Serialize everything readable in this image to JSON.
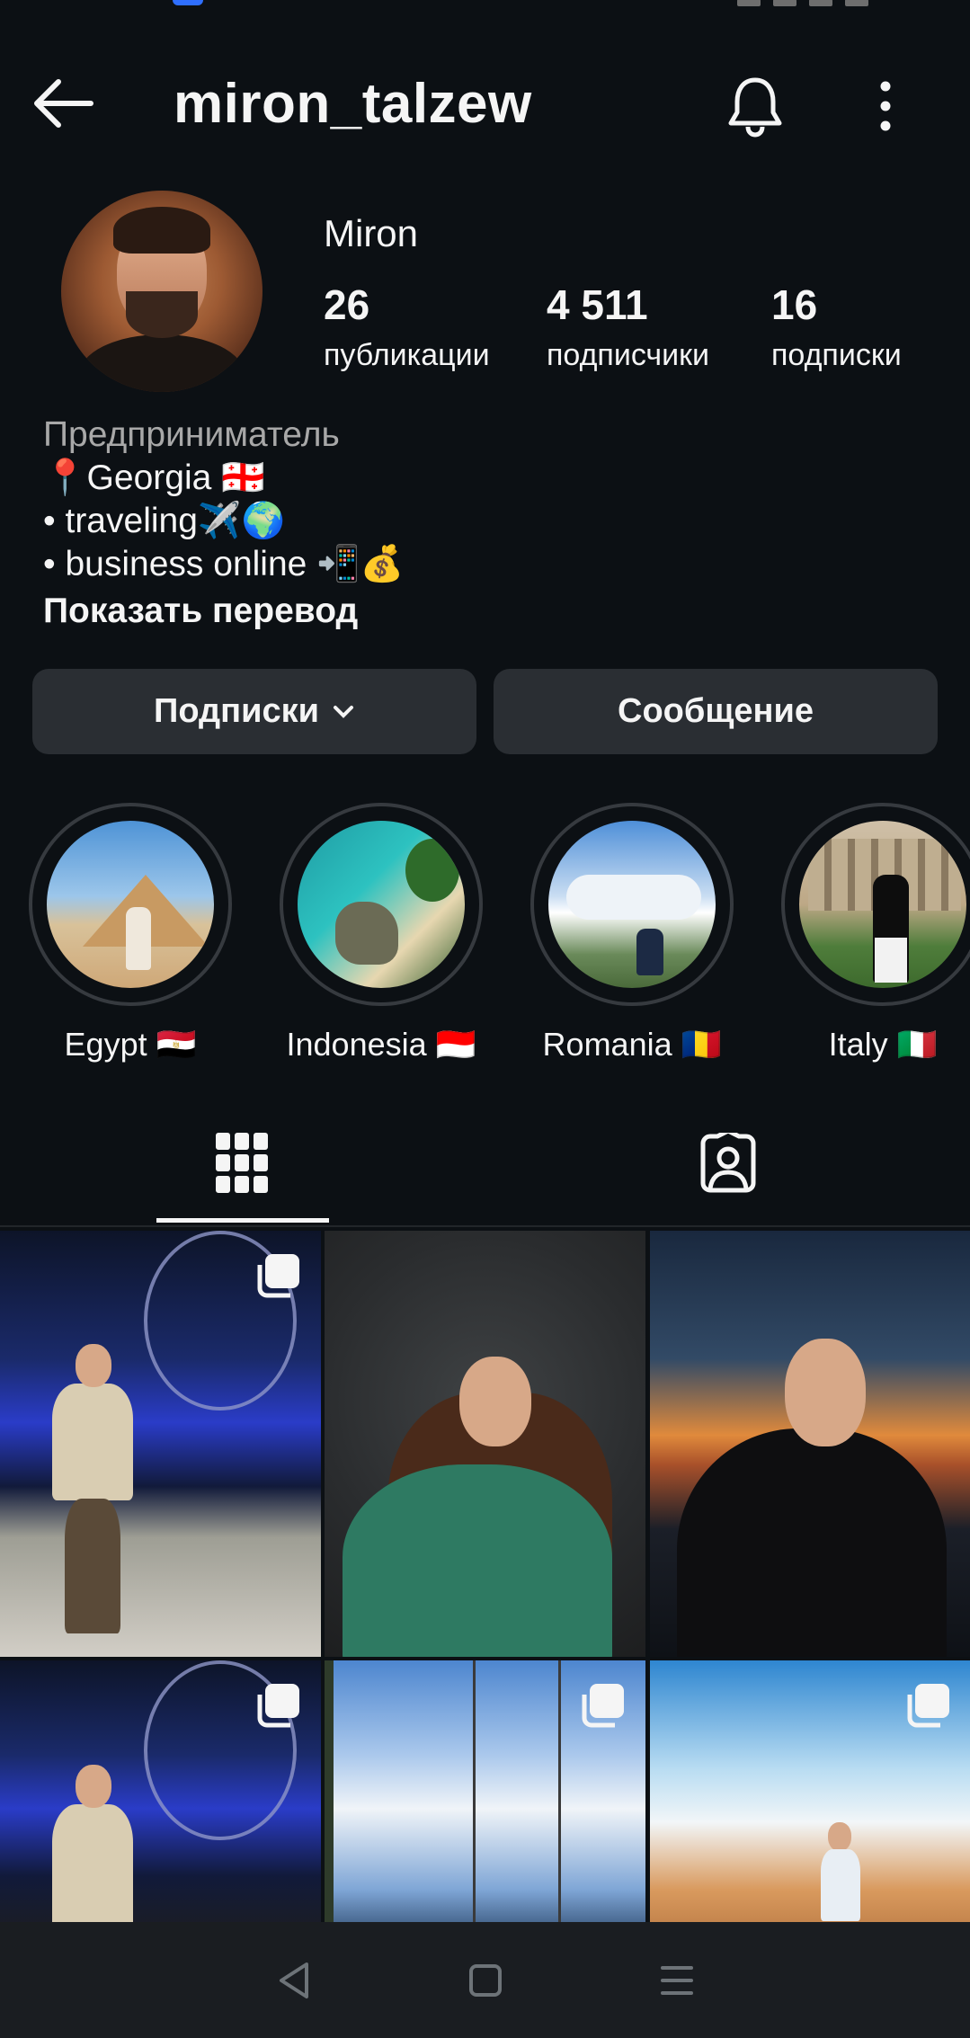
{
  "header": {
    "username": "miron_talzew",
    "icons": {
      "back": "arrow-left-icon",
      "notifications": "bell-icon",
      "more": "more-vertical-icon"
    }
  },
  "profile": {
    "display_name": "Miron",
    "stats": [
      {
        "value": "26",
        "label": "публикации"
      },
      {
        "value": "4 511",
        "label": "подписчики"
      },
      {
        "value": "16",
        "label": "подписки"
      }
    ],
    "bio": {
      "category": "Предприниматель",
      "lines": [
        "📍Georgia 🇬🇪",
        "• traveling✈️🌍",
        "• business online 📲💰"
      ],
      "translate_link": "Показать перевод"
    }
  },
  "actions": {
    "following_label": "Подписки",
    "message_label": "Сообщение"
  },
  "highlights": [
    {
      "label": "Egypt 🇪🇬"
    },
    {
      "label": "Indonesia 🇮🇩"
    },
    {
      "label": "Romania 🇷🇴"
    },
    {
      "label": "Italy 🇮🇹"
    }
  ],
  "tabs": {
    "active": "posts",
    "icons": [
      "grid-icon",
      "tagged-user-icon"
    ]
  },
  "posts": [
    {
      "multi": true
    },
    {
      "multi": false
    },
    {
      "multi": false
    },
    {
      "multi": true
    },
    {
      "multi": true
    },
    {
      "multi": true
    }
  ],
  "navbar": {
    "icons": [
      "back-triangle-icon",
      "home-square-icon",
      "menu-lines-icon"
    ]
  },
  "colors": {
    "background": "#0c1014",
    "button": "#2a2e33",
    "text": "#f5f5f5",
    "muted": "#a8a8a8"
  }
}
